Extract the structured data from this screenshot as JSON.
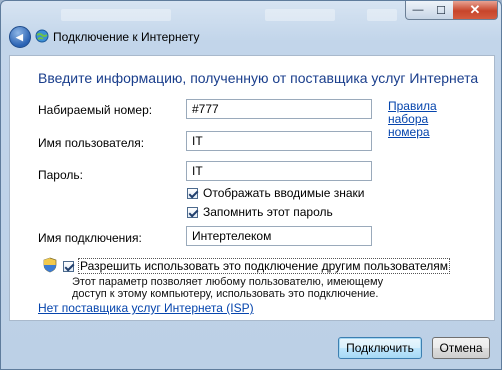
{
  "window": {
    "title": "Подключение к Интернету",
    "min_glyph": "—",
    "max_glyph": "☐",
    "close_glyph": "✕"
  },
  "nav": {
    "back_glyph": "◀"
  },
  "content": {
    "heading": "Введите информацию, полученную от поставщика услуг Интернета",
    "fields": {
      "dial_label": "Набираемый номер:",
      "dial_value": "#777",
      "user_label": "Имя пользователя:",
      "user_value": "IT",
      "password_label": "Пароль:",
      "password_value": "IT",
      "connection_label": "Имя подключения:",
      "connection_value": "Интертелеком"
    },
    "dial_rules_link": "Правила набора номера",
    "show_chars_label": "Отображать вводимые знаки",
    "remember_password_label": "Запомнить этот пароль",
    "allow_others_label": "Разрешить использовать это подключение другим пользователям",
    "allow_others_desc": "Этот параметр позволяет любому пользователю, имеющему доступ к этому компьютеру, использовать это подключение.",
    "no_isp_link": "Нет поставщика услуг Интернета (ISP)"
  },
  "buttons": {
    "connect": "Подключить",
    "cancel": "Отмена"
  },
  "colors": {
    "heading": "#1a3e8c",
    "link": "#0645ad",
    "close_button": "#c7452b"
  },
  "icons": [
    "back-arrow-icon",
    "network-globe-icon",
    "uac-shield-icon",
    "checkmark-icon"
  ]
}
